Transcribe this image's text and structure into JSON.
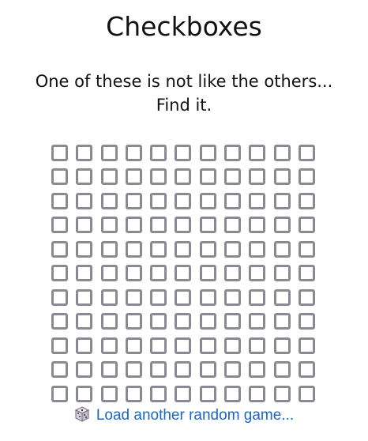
{
  "page": {
    "title": "Checkboxes",
    "subtitle_line1": "One of these is not like the others...",
    "subtitle_line2": "Find it."
  },
  "grid": {
    "rows": 11,
    "columns": 11,
    "checkbox_count": 121,
    "checked_indices": []
  },
  "footer": {
    "link_label": "Load another random game...",
    "icon": "dice-icon"
  },
  "colors": {
    "checkbox_border": "#8a8a92",
    "link": "#1a66c9",
    "text": "#111111"
  }
}
